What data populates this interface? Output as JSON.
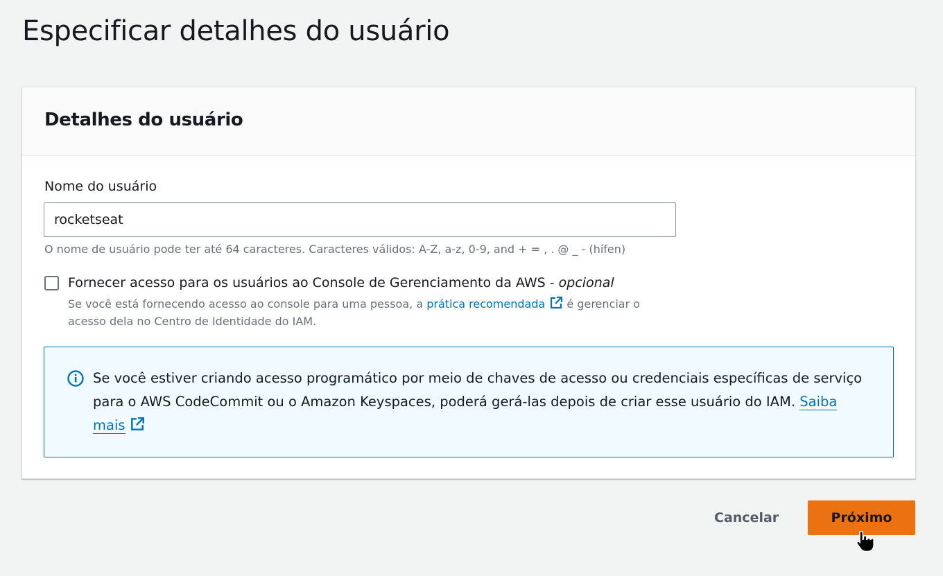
{
  "page": {
    "title": "Especificar detalhes do usuário"
  },
  "panel": {
    "title": "Detalhes do usuário",
    "username": {
      "label": "Nome do usuário",
      "value": "rocketseat",
      "hint": "O nome de usuário pode ter até 64 caracteres. Caracteres válidos: A-Z, a-z, 0-9, and + = , . @ _ - (hífen)"
    },
    "console_access": {
      "label": "Fornecer acesso para os usuários ao Console de Gerenciamento da AWS - ",
      "label_optional": "opcional",
      "checked": false,
      "desc_before": "Se você está fornecendo acesso ao console para uma pessoa, a ",
      "desc_link": "prática recomendada",
      "desc_after": " é gerenciar o acesso dela no Centro de Identidade do IAM."
    },
    "info": {
      "text": "Se você estiver criando acesso programático por meio de chaves de acesso ou credenciais específicas de serviço para o AWS CodeCommit ou o Amazon Keyspaces, poderá gerá-las depois de criar esse usuário do IAM. ",
      "link": "Saiba mais"
    }
  },
  "footer": {
    "cancel_label": "Cancelar",
    "next_label": "Próximo"
  },
  "colors": {
    "accent": "#ec7211",
    "link": "#0073bb",
    "info_bg": "#f1faff"
  },
  "icons": [
    "external-link-icon",
    "info-icon",
    "hand-cursor-icon"
  ]
}
